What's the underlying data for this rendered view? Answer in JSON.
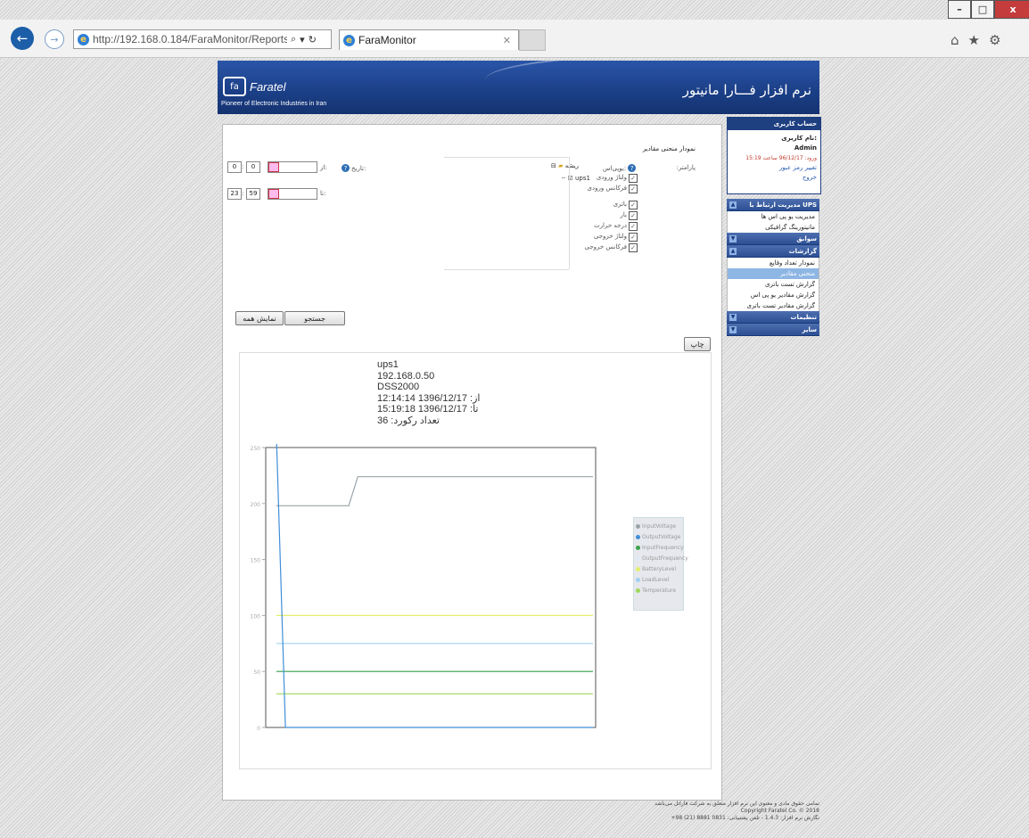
{
  "browser": {
    "url": "http://192.168.0.184/FaraMonitor/Reports/I",
    "tab_title": "FaraMonitor",
    "window_buttons": {
      "minimize": "–",
      "maximize": "□",
      "close": "x"
    }
  },
  "header": {
    "brand": "Faratel",
    "slogan": "Pioneer of Electronic Industries in Iran",
    "app_title": "نرم افزار فـــارا مانیتور"
  },
  "form": {
    "title": "نمودار منحنی مقادیر",
    "param_label": "پارامتر:",
    "parameters": [
      "ولتاژ ورودی",
      "فرکانس ورودی",
      "باتری",
      "بار",
      "درجه حرارت",
      "ولتاژ خروجی",
      "فرکانس خروجی"
    ],
    "ups_label": "یو‌پی‌اس:",
    "tree_root": "ریشه",
    "tree_ups": "ups1",
    "date_label": "تاریخ:",
    "from_label": "از:",
    "to_label": "تا:",
    "from_hour": "0",
    "from_minute": "0",
    "to_hour": "23",
    "to_minute": "59",
    "search_button": "جستجو",
    "show_all_button": "نمایش همه",
    "print_button": "چاپ"
  },
  "chart_info": {
    "ups_name": "ups1",
    "ip": "192.168.0.50",
    "model": "DSS2000",
    "from": "از: 1396/12/17  12:14:14",
    "to": "تا: 1396/12/17  15:19:18",
    "records": "تعداد رکورد: 36"
  },
  "chart_data": {
    "type": "line",
    "ylim": [
      0,
      250
    ],
    "yticks": [
      "250",
      "200",
      "150",
      "100",
      "50",
      "0"
    ],
    "x": [
      0,
      1,
      2,
      3,
      4,
      5,
      6,
      7,
      8,
      9,
      10,
      11,
      12,
      13,
      14,
      15,
      16,
      17,
      18,
      19,
      20,
      21,
      22,
      23,
      24,
      25,
      26,
      27,
      28,
      29,
      30,
      31,
      32,
      33,
      34,
      35
    ],
    "series": [
      {
        "name": "InputVoltage",
        "color": "#9aa3a8",
        "values": [
          198,
          198,
          198,
          198,
          198,
          198,
          198,
          198,
          198,
          224,
          224,
          224,
          224,
          224,
          224,
          224,
          224,
          224,
          224,
          224,
          224,
          224,
          224,
          224,
          224,
          224,
          224,
          224,
          224,
          224,
          224,
          224,
          224,
          224,
          224,
          224
        ]
      },
      {
        "name": "OutputVoltage",
        "color": "#3f8fd8",
        "values": [
          260,
          0,
          0,
          0,
          0,
          0,
          0,
          0,
          0,
          0,
          0,
          0,
          0,
          0,
          0,
          0,
          0,
          0,
          0,
          0,
          0,
          0,
          0,
          0,
          0,
          0,
          0,
          0,
          0,
          0,
          0,
          0,
          0,
          0,
          0,
          0
        ]
      },
      {
        "name": "InputFrequency",
        "color": "#3aa44a",
        "values": [
          50,
          50,
          50,
          50,
          50,
          50,
          50,
          50,
          50,
          50,
          50,
          50,
          50,
          50,
          50,
          50,
          50,
          50,
          50,
          50,
          50,
          50,
          50,
          50,
          50,
          50,
          50,
          50,
          50,
          50,
          50,
          50,
          50,
          50,
          50,
          50
        ]
      },
      {
        "name": "OutputFrequency",
        "color": "#dfe8f5",
        "values": [
          50,
          50,
          50,
          50,
          50,
          50,
          50,
          50,
          50,
          50,
          50,
          50,
          50,
          50,
          50,
          50,
          50,
          50,
          50,
          50,
          50,
          50,
          50,
          50,
          50,
          50,
          50,
          50,
          50,
          50,
          50,
          50,
          50,
          50,
          50,
          50
        ]
      },
      {
        "name": "BatteryLevel",
        "color": "#e3ef6a",
        "values": [
          100,
          100,
          100,
          100,
          100,
          100,
          100,
          100,
          100,
          100,
          100,
          100,
          100,
          100,
          100,
          100,
          100,
          100,
          100,
          100,
          100,
          100,
          100,
          100,
          100,
          100,
          100,
          100,
          100,
          100,
          100,
          100,
          100,
          100,
          100,
          100
        ]
      },
      {
        "name": "LoadLevel",
        "color": "#9fd0f0",
        "values": [
          75,
          75,
          75,
          75,
          75,
          75,
          75,
          75,
          75,
          75,
          75,
          75,
          75,
          75,
          75,
          75,
          75,
          75,
          75,
          75,
          75,
          75,
          75,
          75,
          75,
          75,
          75,
          75,
          75,
          75,
          75,
          75,
          75,
          75,
          75,
          75
        ]
      },
      {
        "name": "Temperature",
        "color": "#9ed85a",
        "values": [
          30,
          30,
          30,
          30,
          30,
          30,
          30,
          30,
          30,
          30,
          30,
          30,
          30,
          30,
          30,
          30,
          30,
          30,
          30,
          30,
          30,
          30,
          30,
          30,
          30,
          30,
          30,
          30,
          30,
          30,
          30,
          30,
          30,
          30,
          30,
          30
        ]
      }
    ],
    "legend_position": "right"
  },
  "sidebar": {
    "account_title": "حساب کاربری",
    "username_label": "نام کاربری:",
    "username": "Admin",
    "last_login": "ورود: 96/12/17 ساعت 15:19",
    "change_password": "تغییر رمز عبور",
    "logout": "خروج",
    "sections": [
      {
        "title": "مدیریت ارتباط با UPS",
        "toggle": "▲",
        "items": [
          "مدیریت یو پی اس ها",
          "مانیتورینگ گرافیکی"
        ]
      },
      {
        "title": "سوابق",
        "toggle": "▼",
        "items": []
      },
      {
        "title": "گزارشات",
        "toggle": "▲",
        "items": [
          "نمودار تعداد وقایع",
          "منحنی مقادیر",
          "گزارش تست باتری",
          "گزارش مقادیر یو پی اس",
          "گزارش مقادیر تست باتری"
        ]
      },
      {
        "title": "تنظیمات",
        "toggle": "▼",
        "items": []
      },
      {
        "title": "سایر",
        "toggle": "▼",
        "items": []
      }
    ]
  },
  "footer": {
    "line1": "تمامی حقوق مادی و معنوی این نرم افزار متعلق به شرکت فاراتل می‌باشد",
    "copyright": "Copyright Faratel Co. © 2018",
    "line2": "نگارش نرم افزار: 1.4.3 - تلفن پشتیبانی: 0831 8881 (21) 98+"
  }
}
